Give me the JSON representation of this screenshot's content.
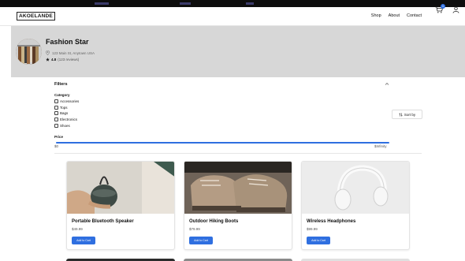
{
  "navbar": {
    "logo": "AKOELANDE",
    "links": [
      "Shop",
      "About",
      "Contact"
    ],
    "cart_count": "1",
    "icons": {
      "cart": "shopping-cart-icon",
      "user": "user-icon"
    }
  },
  "store": {
    "name": "Fashion Star",
    "address": "123 Main St, Anytown USA",
    "rating": "4.8",
    "reviews": "(123 reviews)"
  },
  "filters": {
    "title": "Filters",
    "category_title": "Category",
    "categories": [
      "Accessories",
      "Tops",
      "Bags",
      "Electronics",
      "Shoes"
    ],
    "sort_label": "Sort by",
    "price_title": "Price",
    "price_min": "$0",
    "price_max": "$Infinity"
  },
  "products": [
    {
      "name": "Portable Bluetooth Speaker",
      "price": "$49.99",
      "button": "Add to Cart"
    },
    {
      "name": "Outdoor Hiking Boots",
      "price": "$79.99",
      "button": "Add to Cart"
    },
    {
      "name": "Wireless Headphones",
      "price": "$99.99",
      "button": "Add to Cart"
    }
  ],
  "colors": {
    "accent": "#2f6fe0",
    "hero_bg": "#d7d7d7",
    "top_strip": "#0d0d0d"
  }
}
